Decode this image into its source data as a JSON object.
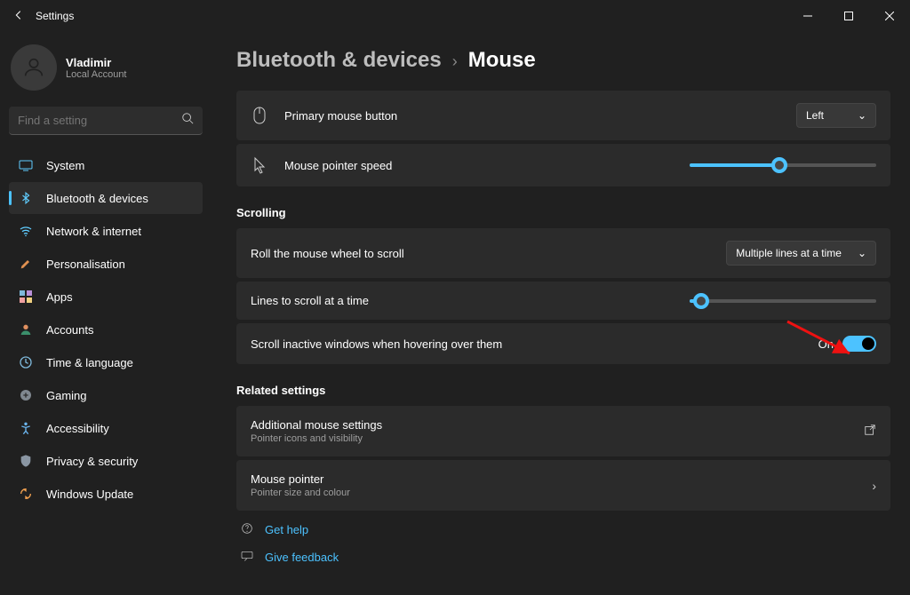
{
  "window": {
    "title": "Settings"
  },
  "user": {
    "name": "Vladimir",
    "type": "Local Account"
  },
  "search": {
    "placeholder": "Find a setting"
  },
  "sidebar": {
    "items": [
      {
        "label": "System"
      },
      {
        "label": "Bluetooth & devices"
      },
      {
        "label": "Network & internet"
      },
      {
        "label": "Personalisation"
      },
      {
        "label": "Apps"
      },
      {
        "label": "Accounts"
      },
      {
        "label": "Time & language"
      },
      {
        "label": "Gaming"
      },
      {
        "label": "Accessibility"
      },
      {
        "label": "Privacy & security"
      },
      {
        "label": "Windows Update"
      }
    ]
  },
  "breadcrumb": {
    "parent": "Bluetooth & devices",
    "current": "Mouse"
  },
  "settings": {
    "primary_button": {
      "label": "Primary mouse button",
      "value": "Left"
    },
    "pointer_speed": {
      "label": "Mouse pointer speed",
      "percent": 48
    },
    "scrolling": {
      "title": "Scrolling",
      "roll": {
        "label": "Roll the mouse wheel to scroll",
        "value": "Multiple lines at a time"
      },
      "lines": {
        "label": "Lines to scroll at a time",
        "percent": 6
      },
      "inactive": {
        "label": "Scroll inactive windows when hovering over them",
        "value": "On"
      }
    },
    "related": {
      "title": "Related settings",
      "additional": {
        "label": "Additional mouse settings",
        "sub": "Pointer icons and visibility"
      },
      "pointer": {
        "label": "Mouse pointer",
        "sub": "Pointer size and colour"
      }
    }
  },
  "footer": {
    "help": "Get help",
    "feedback": "Give feedback"
  }
}
